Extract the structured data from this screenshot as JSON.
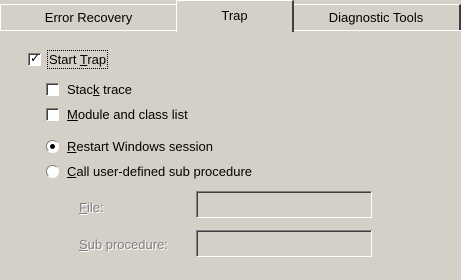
{
  "tabs": [
    {
      "label": "Error Recovery",
      "active": false
    },
    {
      "label": "Trap",
      "active": true
    },
    {
      "label": "Diagnostic Tools",
      "active": false
    }
  ],
  "options": {
    "start_trap": {
      "pre": "Start ",
      "access": "T",
      "post": "rap",
      "checked": true
    },
    "stack_trace": {
      "pre": "Stac",
      "access": "k",
      "post": " trace",
      "checked": false
    },
    "module_list": {
      "pre": "",
      "access": "M",
      "post": "odule and class list",
      "checked": false
    },
    "restart_windows": {
      "pre": "",
      "access": "R",
      "post": "estart Windows session",
      "selected": true
    },
    "call_sub": {
      "pre": "",
      "access": "C",
      "post": "all user-defined sub procedure",
      "selected": false
    }
  },
  "fields": {
    "file": {
      "access": "F",
      "post": "ile:",
      "value": "",
      "enabled": false
    },
    "sub_procedure": {
      "access": "S",
      "post": "ub procedure:",
      "value": "",
      "enabled": false
    }
  }
}
